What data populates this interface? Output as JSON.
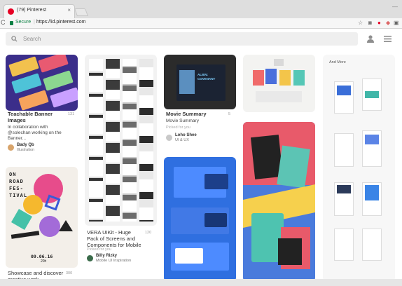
{
  "browser": {
    "tab_title": "(79) Pinterest",
    "tab_close": "×",
    "secure_label": "Secure",
    "url_sep": "|",
    "url": "https://id.pinterest.com",
    "reload": "C"
  },
  "search": {
    "placeholder": "Search"
  },
  "pins": [
    {
      "title": "Teachable Banner Images",
      "desc": "In collaboration with @solechan working on the Banner...",
      "count": "131",
      "owner": "Bady Qb",
      "board": "Illustration"
    },
    {
      "title": "VERA UIKit - Huge Pack of Screens and Components for Mobile",
      "sub": "Picked for you",
      "count": "120",
      "owner": "Billy Rizky",
      "board": "Mobile UI Inspiration"
    },
    {
      "title": "Movie Summary",
      "desc": "Movie Summary",
      "sub": "Picked for you",
      "count": "5",
      "owner": "Loho Shee",
      "board": "UI & UX"
    },
    {
      "title": "Showcase and discover creative work",
      "count": "300"
    }
  ],
  "poster": {
    "line1": "ON",
    "line2": "ROAD",
    "line3": "FES-",
    "line4": "TIVAL",
    "date": "09.06.16",
    "time": "20h"
  },
  "movie_card": {
    "heading": "ALIEN: COVENANT"
  },
  "moodboard": {
    "heading": "And More"
  },
  "colors": {
    "pinterest_red": "#e60023",
    "secure_green": "#0b8043"
  }
}
